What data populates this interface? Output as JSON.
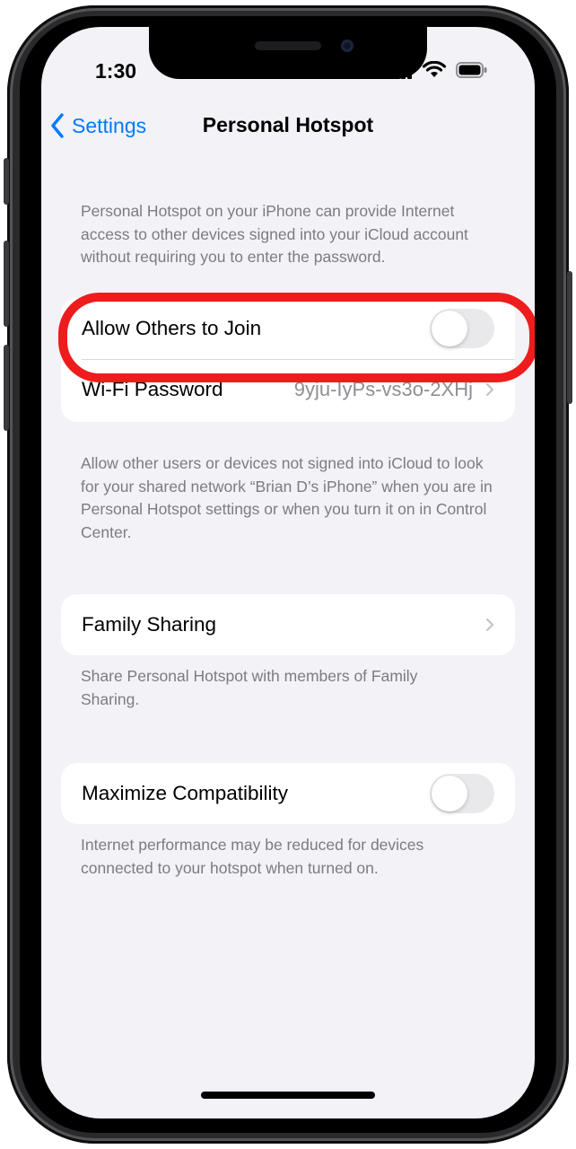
{
  "status_bar": {
    "time": "1:30"
  },
  "nav": {
    "back_label": "Settings",
    "title": "Personal Hotspot"
  },
  "intro_text": "Personal Hotspot on your iPhone can provide Internet access to other devices signed into your iCloud account without requiring you to enter the password.",
  "group_join": {
    "allow_others_label": "Allow Others to Join",
    "allow_others_on": false,
    "wifi_password_label": "Wi-Fi Password",
    "wifi_password_value": "9yju-IyPs-vs3o-2XHj"
  },
  "join_footer": "Allow other users or devices not signed into iCloud to look for your shared network “Brian D’s iPhone” when you are in Personal Hotspot settings or when you turn it on in Control Center.",
  "group_family": {
    "family_sharing_label": "Family Sharing"
  },
  "family_footer": "Share Personal Hotspot with members of Family Sharing.",
  "group_compat": {
    "maximize_label": "Maximize Compatibility",
    "maximize_on": false
  },
  "compat_footer": "Internet performance may be reduced for devices connected to your hotspot when turned on.",
  "colors": {
    "accent": "#007aff",
    "highlight": "#ee1c1c",
    "background": "#f2f2f7",
    "secondary_text": "#7c7c80"
  },
  "icons": [
    "chevron-left-icon",
    "chevron-right-icon",
    "signal-icon",
    "wifi-icon",
    "battery-icon"
  ]
}
